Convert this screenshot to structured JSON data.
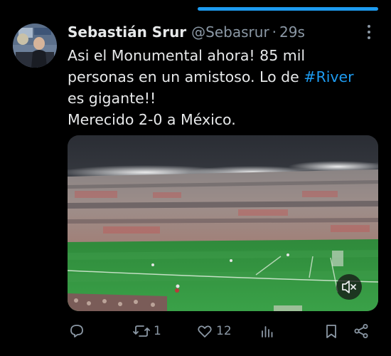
{
  "tweet": {
    "author_name": "Sebastián Srur",
    "author_handle": "@Sebasrur",
    "separator": "·",
    "time": "29s",
    "text_lines": [
      [
        "Asi el Monumental ahora! 85 mil"
      ],
      [
        "personas en un amistoso. Lo de ",
        "#River"
      ],
      [
        "es gigante!!"
      ],
      [
        "Merecido 2-0 a México."
      ]
    ],
    "line1": "Asi el Monumental ahora! 85 mil",
    "line2_a": "personas en un amistoso. Lo de ",
    "line2_hashtag": "#River",
    "line3": "es gigante!!",
    "line4": "Merecido 2-0 a México."
  },
  "media": {
    "type": "video",
    "description_icons": [
      "stadium-photo"
    ],
    "mute_icon": "speaker-muted-icon"
  },
  "actions": {
    "reply_count": "",
    "retweet_count": "1",
    "like_count": "12",
    "views_count": "",
    "icons": [
      "reply-icon",
      "retweet-icon",
      "like-icon",
      "views-icon",
      "bookmark-icon",
      "share-icon"
    ]
  },
  "colors": {
    "background": "#000000",
    "text": "#e7e9ea",
    "secondary": "#8b98a5",
    "accent": "#1d9bf0"
  }
}
